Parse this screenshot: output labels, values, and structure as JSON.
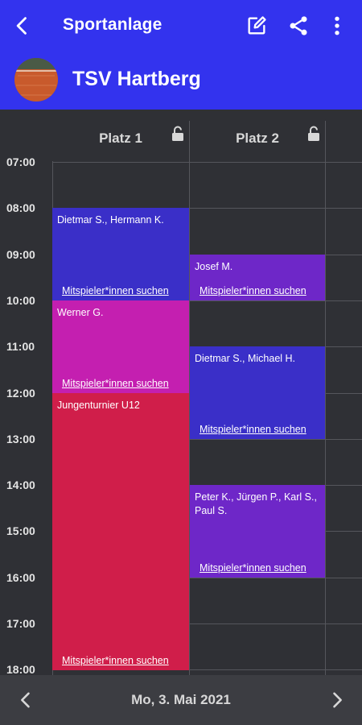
{
  "appbar": {
    "title": "Sportanlage",
    "icons": {
      "back": "arrow-back-icon",
      "edit": "edit-icon",
      "share": "share-icon",
      "more": "more-vert-icon"
    },
    "color": "#3333ee"
  },
  "club": {
    "name": "TSV Hartberg",
    "logo": "club-logo-icon"
  },
  "calendar": {
    "courts": [
      {
        "label": "Platz 1",
        "lock_icon": "lock-open-icon"
      },
      {
        "label": "Platz 2",
        "lock_icon": "lock-open-icon"
      }
    ],
    "hours": [
      "07:00",
      "08:00",
      "09:00",
      "10:00",
      "11:00",
      "12:00",
      "13:00",
      "14:00",
      "15:00",
      "16:00",
      "17:00",
      "18:00"
    ],
    "events": [
      {
        "court": 1,
        "start": "08:00",
        "end": "10:00",
        "players": "Dietmar S., Hermann K.",
        "action": "Mitspieler*innen suchen",
        "color": "#3a2fc8"
      },
      {
        "court": 1,
        "start": "10:00",
        "end": "12:00",
        "players": "Werner G.",
        "action": "Mitspieler*innen suchen",
        "color": "#c41fb0"
      },
      {
        "court": 1,
        "start": "12:00",
        "end": "18:00",
        "players": "Jungenturnier U12",
        "action": "Mitspieler*innen suchen",
        "color": "#d01e4a"
      },
      {
        "court": 2,
        "start": "09:00",
        "end": "10:00",
        "players": "Josef M.",
        "action": "Mitspieler*innen suchen",
        "color": "#6e27c8"
      },
      {
        "court": 2,
        "start": "11:00",
        "end": "13:00",
        "players": "Dietmar S., Michael H.",
        "action": "Mitspieler*innen suchen",
        "color": "#3a2fc8"
      },
      {
        "court": 2,
        "start": "14:00",
        "end": "16:00",
        "players": "Peter K., Jürgen P., Karl S., Paul S.",
        "action": "Mitspieler*innen suchen",
        "color": "#6e27c8"
      }
    ]
  },
  "footer": {
    "date": "Mo, 3. Mai 2021",
    "icons": {
      "prev": "chevron-left-icon",
      "next": "chevron-right-icon"
    }
  }
}
